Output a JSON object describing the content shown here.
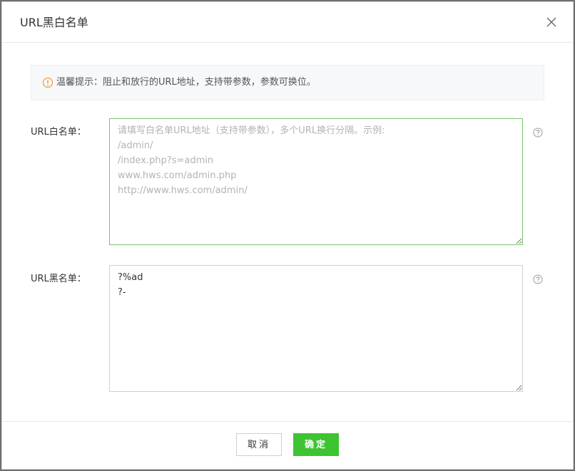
{
  "dialog": {
    "title": "URL黑白名单",
    "tip": "温馨提示：阻止和放行的URL地址，支持带参数，参数可换位。",
    "whitelist": {
      "label": "URL白名单：",
      "placeholder": "请填写白名单URL地址（支持带参数），多个URL换行分隔。示例:\n/admin/\n/index.php?s=admin\nwww.hws.com/admin.php\nhttp://www.hws.com/admin/",
      "value": ""
    },
    "blacklist": {
      "label": "URL黑名单：",
      "placeholder": "",
      "value": "?%ad\n?-"
    },
    "buttons": {
      "cancel": "取消",
      "ok": "确定"
    }
  },
  "colors": {
    "accent": "#3ec432",
    "warning": "#f0a040",
    "focus_border": "#77c36a"
  },
  "icons": {
    "close": "close-icon",
    "tip": "warning-circle-icon",
    "help": "question-circle-icon"
  }
}
